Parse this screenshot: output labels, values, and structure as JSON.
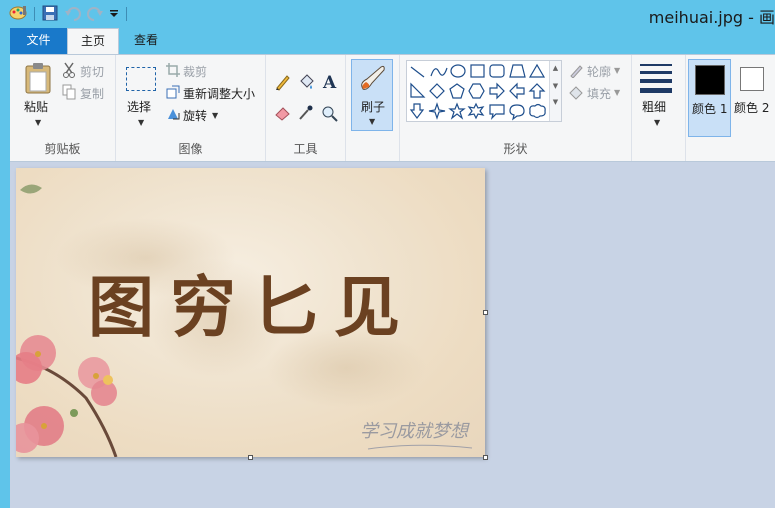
{
  "window": {
    "title": "meihuai.jpg - 画"
  },
  "tabs": {
    "file": "文件",
    "home": "主页",
    "view": "查看"
  },
  "clipboard": {
    "paste": "粘贴",
    "cut": "剪切",
    "copy": "复制",
    "group": "剪贴板"
  },
  "image_group": {
    "select": "选择",
    "crop": "裁剪",
    "resize": "重新调整大小",
    "rotate": "旋转",
    "group": "图像"
  },
  "tools": {
    "group": "工具"
  },
  "brushes": {
    "label": "刷子"
  },
  "shapes": {
    "outline": "轮廓",
    "fill": "填充",
    "group": "形状"
  },
  "size": {
    "label": "粗细"
  },
  "colors": {
    "color1": "颜色 1",
    "color2": "颜色 2",
    "color1_value": "#000000",
    "color2_value": "#ffffff"
  },
  "canvas": {
    "calligraphy": "图穷匕见",
    "signature": "学习成就梦想"
  }
}
